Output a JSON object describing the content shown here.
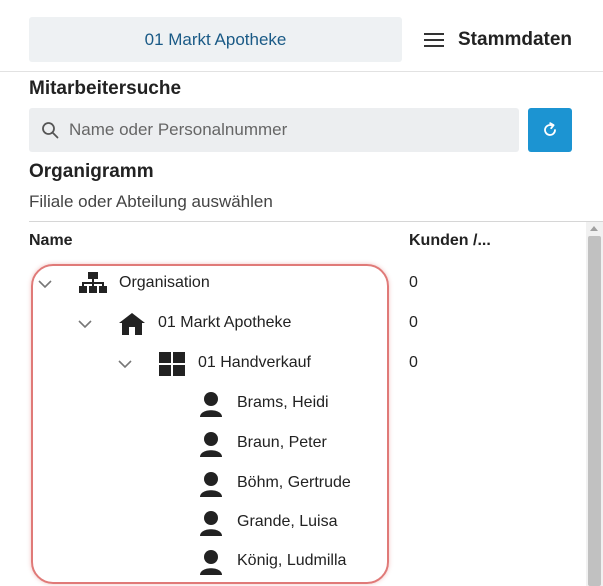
{
  "header": {
    "branch_label": "01 Markt Apotheke",
    "menu_label": "Stammdaten"
  },
  "employee_search": {
    "title": "Mitarbeitersuche",
    "placeholder": "Name oder Personalnummer"
  },
  "org_chart": {
    "title": "Organigramm",
    "subtitle": "Filiale oder Abteilung auswählen",
    "columns": {
      "name": "Name",
      "customers": "Kunden /..."
    },
    "tree": [
      {
        "label": "Organisation",
        "count": "0",
        "icon": "sitemap-icon",
        "expanded": true
      },
      {
        "label": "01 Markt Apotheke",
        "count": "0",
        "icon": "home-icon",
        "expanded": true
      },
      {
        "label": "01 Handverkauf",
        "count": "0",
        "icon": "grid-icon",
        "expanded": true
      },
      {
        "label": "Brams, Heidi",
        "icon": "person-icon"
      },
      {
        "label": "Braun, Peter",
        "icon": "person-icon"
      },
      {
        "label": "Böhm, Gertrude",
        "icon": "person-icon"
      },
      {
        "label": "Grande, Luisa",
        "icon": "person-icon"
      },
      {
        "label": "König, Ludmilla",
        "icon": "person-icon"
      }
    ]
  },
  "colors": {
    "accent": "#1c94d2",
    "branch_text": "#1a5a86",
    "highlight": "#e07a78"
  }
}
